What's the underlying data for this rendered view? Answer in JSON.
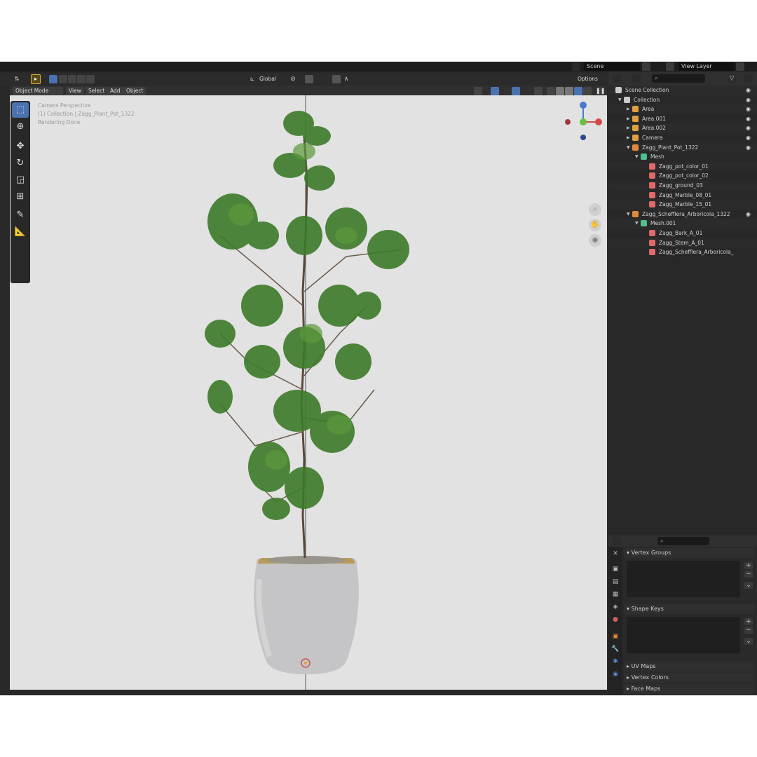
{
  "topbar": {
    "scene_label": "Scene",
    "view_layer_label": "View Layer"
  },
  "header": {
    "transform_orientation": "Global",
    "options_label": "Options"
  },
  "viewport_header": {
    "mode": "Object Mode",
    "menus": [
      "View",
      "Select",
      "Add",
      "Object"
    ]
  },
  "viewport": {
    "info_line1": "Camera Perspective",
    "info_line2": "(1) Collection | Zagg_Plant_Pot_1322",
    "info_line3": "Rendering Done",
    "gizmo": {
      "z": "Z",
      "x": "X"
    }
  },
  "outliner": {
    "rows": [
      {
        "label": "Scene Collection",
        "indent": 0,
        "icon": "scene-collection-icon",
        "color": "#cccccc"
      },
      {
        "label": "Collection",
        "indent": 1,
        "icon": "collection-icon",
        "color": "#cccccc"
      },
      {
        "label": "Area",
        "indent": 2,
        "icon": "light-icon",
        "color": "#e0a040"
      },
      {
        "label": "Area.001",
        "indent": 2,
        "icon": "light-icon",
        "color": "#e0a040"
      },
      {
        "label": "Area.002",
        "indent": 2,
        "icon": "light-icon",
        "color": "#e0a040"
      },
      {
        "label": "Camera",
        "indent": 2,
        "icon": "camera-icon",
        "color": "#e0a040"
      },
      {
        "label": "Zagg_Plant_Pot_1322",
        "indent": 2,
        "icon": "mesh-object-icon",
        "color": "#e08a3a"
      },
      {
        "label": "Mesh",
        "indent": 3,
        "icon": "mesh-data-icon",
        "color": "#4fc08d"
      },
      {
        "label": "Zagg_pot_color_01",
        "indent": 4,
        "icon": "material-icon",
        "color": "#e06a6a"
      },
      {
        "label": "Zagg_pot_color_02",
        "indent": 4,
        "icon": "material-icon",
        "color": "#e06a6a"
      },
      {
        "label": "Zagg_ground_03",
        "indent": 4,
        "icon": "material-icon",
        "color": "#e06a6a"
      },
      {
        "label": "Zagg_Marble_08_01",
        "indent": 4,
        "icon": "material-icon",
        "color": "#e06a6a"
      },
      {
        "label": "Zagg_Marble_15_01",
        "indent": 4,
        "icon": "material-icon",
        "color": "#e06a6a"
      },
      {
        "label": "Zagg_Schefflera_Arboricola_1322",
        "indent": 2,
        "icon": "mesh-object-icon",
        "color": "#e08a3a"
      },
      {
        "label": "Mesh.001",
        "indent": 3,
        "icon": "mesh-data-icon",
        "color": "#4fc08d"
      },
      {
        "label": "Zagg_Bark_A_01",
        "indent": 4,
        "icon": "material-icon",
        "color": "#e06a6a"
      },
      {
        "label": "Zagg_Stem_A_01",
        "indent": 4,
        "icon": "material-icon",
        "color": "#e06a6a"
      },
      {
        "label": "Zagg_Schefflera_Arboricola_",
        "indent": 4,
        "icon": "material-icon",
        "color": "#e06a6a"
      }
    ]
  },
  "properties": {
    "vertex_groups": "Vertex Groups",
    "shape_keys": "Shape Keys",
    "uv_maps": "UV Maps",
    "vertex_colors": "Vertex Colors",
    "face_maps": "Face Maps"
  }
}
